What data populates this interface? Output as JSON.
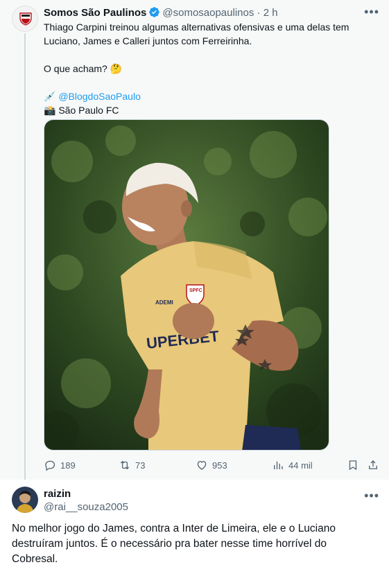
{
  "post": {
    "display_name": "Somos São Paulinos",
    "handle": "@somosaopaulinos",
    "separator": "·",
    "time": "2 h",
    "text_line1": "Thiago Carpini treinou algumas alternativas ofensivas e uma delas tem",
    "text_line2": "Luciano, James e Calleri juntos com Ferreirinha.",
    "question": "O que acham? 🤔",
    "credit_prefix": "💉",
    "credit_link": "@BlogdoSaoPaulo",
    "photo_credit_prefix": "📸",
    "photo_credit": "São Paulo FC",
    "stats": {
      "replies": "189",
      "reposts": "73",
      "likes": "953",
      "views": "44 mil"
    },
    "photo": {
      "shirt_sponsor": "UPERBET",
      "badge": "SPFC",
      "logo": "ADEMI"
    }
  },
  "reply": {
    "display_name": "raizin",
    "handle": "@rai__souza2005",
    "text": "No melhor jogo do James, contra a Inter de Limeira, ele e o Luciano destruíram juntos. É o necessário pra bater nesse time horrível do Cobresal."
  },
  "colors": {
    "accent": "#1d9bf0",
    "muted": "#536471",
    "post_bg": "#f7f9f9"
  }
}
